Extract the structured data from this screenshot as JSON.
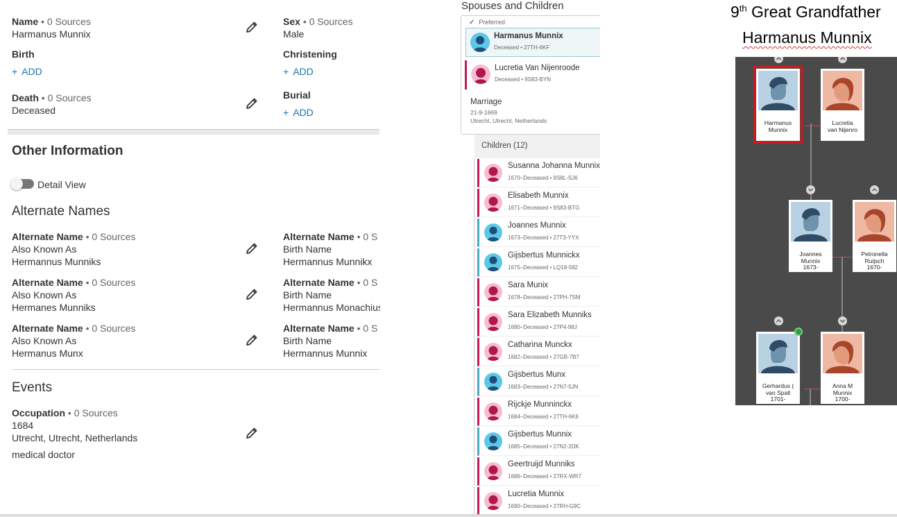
{
  "vitals": {
    "name": {
      "label": "Name",
      "sources": "• 0 Sources",
      "value": "Harmanus Munnix"
    },
    "sex": {
      "label": "Sex",
      "sources": "• 0 Sources",
      "value": "Male"
    },
    "birth": {
      "label": "Birth",
      "add": "ADD"
    },
    "christening": {
      "label": "Christening",
      "add": "ADD"
    },
    "death": {
      "label": "Death",
      "sources": "• 0 Sources",
      "value": "Deceased"
    },
    "burial": {
      "label": "Burial",
      "add": "ADD"
    },
    "add_plus": "+"
  },
  "other_info": {
    "title": "Other Information",
    "detail_view": "Detail View",
    "alternate_names_title": "Alternate Names",
    "alternate_names": [
      {
        "label": "Alternate Name",
        "sources": "• 0 Sources",
        "type": "Also Known As",
        "name": "Hermannus Munniks"
      },
      {
        "label": "Alternate Name",
        "sources": "• 0 S",
        "type": "Birth Name",
        "name": "Hermannus Munnikx"
      },
      {
        "label": "Alternate Name",
        "sources": "• 0 Sources",
        "type": "Also Known As",
        "name": "Hermanes Munniks"
      },
      {
        "label": "Alternate Name",
        "sources": "• 0 S",
        "type": "Birth Name",
        "name": "Hermannus Monachius"
      },
      {
        "label": "Alternate Name",
        "sources": "• 0 Sources",
        "type": "Also Known As",
        "name": "Hermanus Munx"
      },
      {
        "label": "Alternate Name",
        "sources": "• 0 S",
        "type": "Birth Name",
        "name": "Hermannus Munnix"
      }
    ],
    "events_title": "Events",
    "occupation": {
      "label": "Occupation",
      "sources": "• 0 Sources",
      "date": "1684",
      "place": "Utrecht, Utrecht, Netherlands",
      "description": "medical doctor"
    }
  },
  "family": {
    "title": "Spouses and Children",
    "preferred": "Preferred",
    "father": {
      "name": "Harmanus Munnix",
      "meta": "Deceased •  27TH-6KF"
    },
    "mother": {
      "name": "Lucretia Van Nijenroode",
      "meta": "Deceased •  9S83-BYN"
    },
    "marriage_label": "Marriage",
    "marriage_date": "21-9-1669",
    "marriage_place": "Utrecht, Utrecht, Netherlands",
    "children_header": "Children (12)",
    "children": [
      {
        "name": "Susanna Johanna Munnix",
        "meta": "1670–Deceased •  9S8L-SJ6",
        "sex": "f"
      },
      {
        "name": "Elisabeth Munnix",
        "meta": "1671–Deceased •  9S83-BTG",
        "sex": "f"
      },
      {
        "name": "Joannes Munnix",
        "meta": "1673–Deceased •  27T3-YYX",
        "sex": "m"
      },
      {
        "name": "Gijsbertus Munnickx",
        "meta": "1675–Deceased •  LQ18-582",
        "sex": "m"
      },
      {
        "name": "Sara Munix",
        "meta": "1678–Deceased •  27PH-7SM",
        "sex": "f"
      },
      {
        "name": "Sara Elizabeth Munniks",
        "meta": "1680–Deceased •  27P4-98J",
        "sex": "f"
      },
      {
        "name": "Catharina Munckx",
        "meta": "1682–Deceased •  27GB-7B7",
        "sex": "f"
      },
      {
        "name": "Gijsbertus Munx",
        "meta": "1683–Deceased •  27N7-5JN",
        "sex": "m"
      },
      {
        "name": "Rijckje Munninckx",
        "meta": "1684–Deceased •  27TH-6K6",
        "sex": "f"
      },
      {
        "name": "Gijsbertus Munnix",
        "meta": "1685–Deceased •  27N2-2DK",
        "sex": "m"
      },
      {
        "name": "Geertruijd Munniks",
        "meta": "1686–Deceased •  27RX-WR7",
        "sex": "f"
      },
      {
        "name": "Lucretia Munnix",
        "meta": "1690–Deceased •  27RH-G9C",
        "sex": "f"
      }
    ]
  },
  "caption": {
    "line1_num": "9",
    "line1_sup": "th",
    "line1_rest": " Great Grandfather",
    "line2": "Harmanus Munnix"
  },
  "tree": {
    "nodes": [
      {
        "line1": "Harmanus",
        "line2": "Munnix",
        "line3": ""
      },
      {
        "line1": "Lucretia",
        "line2": "van Nijenro",
        "line3": ""
      },
      {
        "line1": "Joannes",
        "line2": "Munnix",
        "line3": "1673-"
      },
      {
        "line1": "Petronella",
        "line2": "Ruijsch",
        "line3": "1670-"
      },
      {
        "line1": "Gerhardus (",
        "line2": "van Spall",
        "line3": "1701-"
      },
      {
        "line1": "Anna M",
        "line2": "Munnix",
        "line3": "1700-"
      }
    ]
  },
  "colors": {
    "female": "#c2185b",
    "male": "#4aa8c7",
    "link": "#1a73a8",
    "tree_bg": "#4a4a4a",
    "selected_outline": "#d6161b"
  }
}
